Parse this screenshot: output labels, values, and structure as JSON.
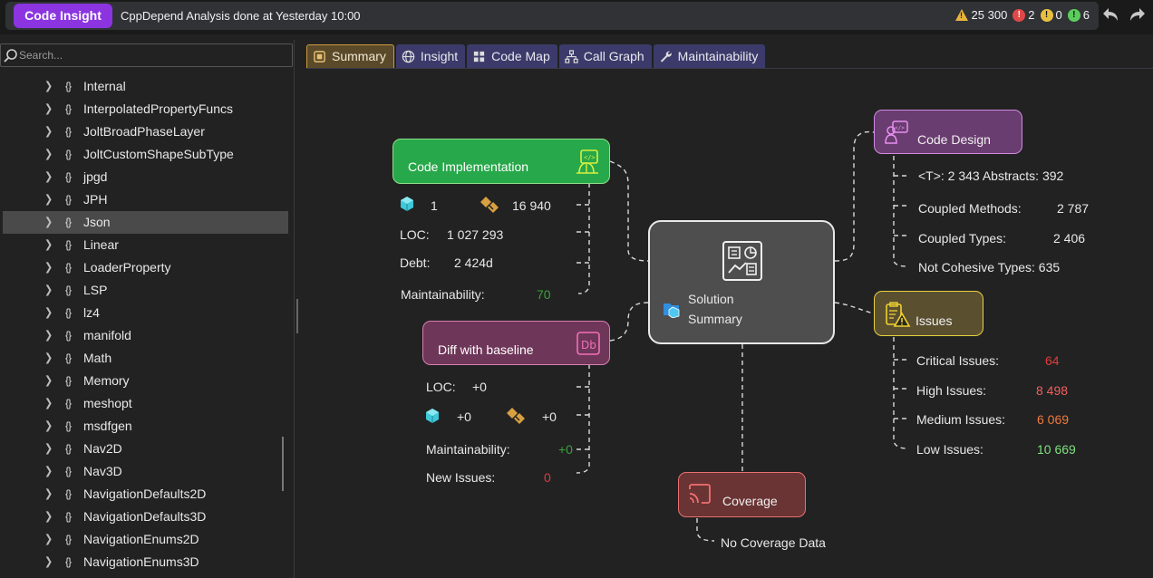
{
  "topbar": {
    "brand": "Code Insight",
    "status": "CppDepend Analysis done at Yesterday 10:00",
    "warnings": "25 300",
    "errors": "2",
    "caution": "0",
    "info": "6"
  },
  "sidebar": {
    "search_placeholder": "Search...",
    "ns_icon": "{}",
    "items": [
      "Internal",
      "InterpolatedPropertyFuncs",
      "JoltBroadPhaseLayer",
      "JoltCustomShapeSubType",
      "jpgd",
      "JPH",
      "Json",
      "Linear",
      "LoaderProperty",
      "LSP",
      "lz4",
      "manifold",
      "Math",
      "Memory",
      "meshopt",
      "msdfgen",
      "Nav2D",
      "Nav3D",
      "NavigationDefaults2D",
      "NavigationDefaults3D",
      "NavigationEnums2D",
      "NavigationEnums3D"
    ],
    "selected": "Json"
  },
  "tabs": [
    "Summary",
    "Insight",
    "Code Map",
    "Call Graph",
    "Maintainability"
  ],
  "summary": {
    "center": {
      "line1": "Solution",
      "line2": "Summary"
    },
    "impl": {
      "title": "Code Implementation",
      "projects": "1",
      "types": "16 940",
      "loc_label": "LOC:",
      "loc": "1 027 293",
      "debt_label": "Debt:",
      "debt": "2 424d",
      "maint_label": "Maintainability:",
      "maint": "70"
    },
    "diff": {
      "title": "Diff with baseline",
      "loc_label": "LOC:",
      "loc": "+0",
      "projects": "+0",
      "types": "+0",
      "maint_label": "Maintainability:",
      "maint": "+0",
      "new_label": "New Issues:",
      "new": "0"
    },
    "design": {
      "title": "Code Design",
      "generic": "<T>: 2 343 Abstracts: 392",
      "coupled_methods_label": "Coupled Methods:",
      "coupled_methods": "2 787",
      "coupled_types_label": "Coupled Types:",
      "coupled_types": "2 406",
      "not_cohesive": "Not Cohesive Types: 635"
    },
    "issues": {
      "title": "Issues",
      "critical_label": "Critical Issues:",
      "critical": "64",
      "high_label": "High Issues:",
      "high": "8 498",
      "medium_label": "Medium Issues:",
      "medium": "6 069",
      "low_label": "Low Issues:",
      "low": "10 669"
    },
    "coverage": {
      "title": "Coverage",
      "note": "No Coverage Data"
    }
  },
  "colors": {
    "impl": "#27a84a",
    "diff": "#6e3658",
    "design": "#6a3d70",
    "issues": "#5a5030",
    "coverage": "#6a3434",
    "green_val": "#3ca03c",
    "red_val": "#e03c3c",
    "high_val": "#f06060",
    "medium_val": "#f07a40",
    "low_val": "#7ee07e"
  }
}
